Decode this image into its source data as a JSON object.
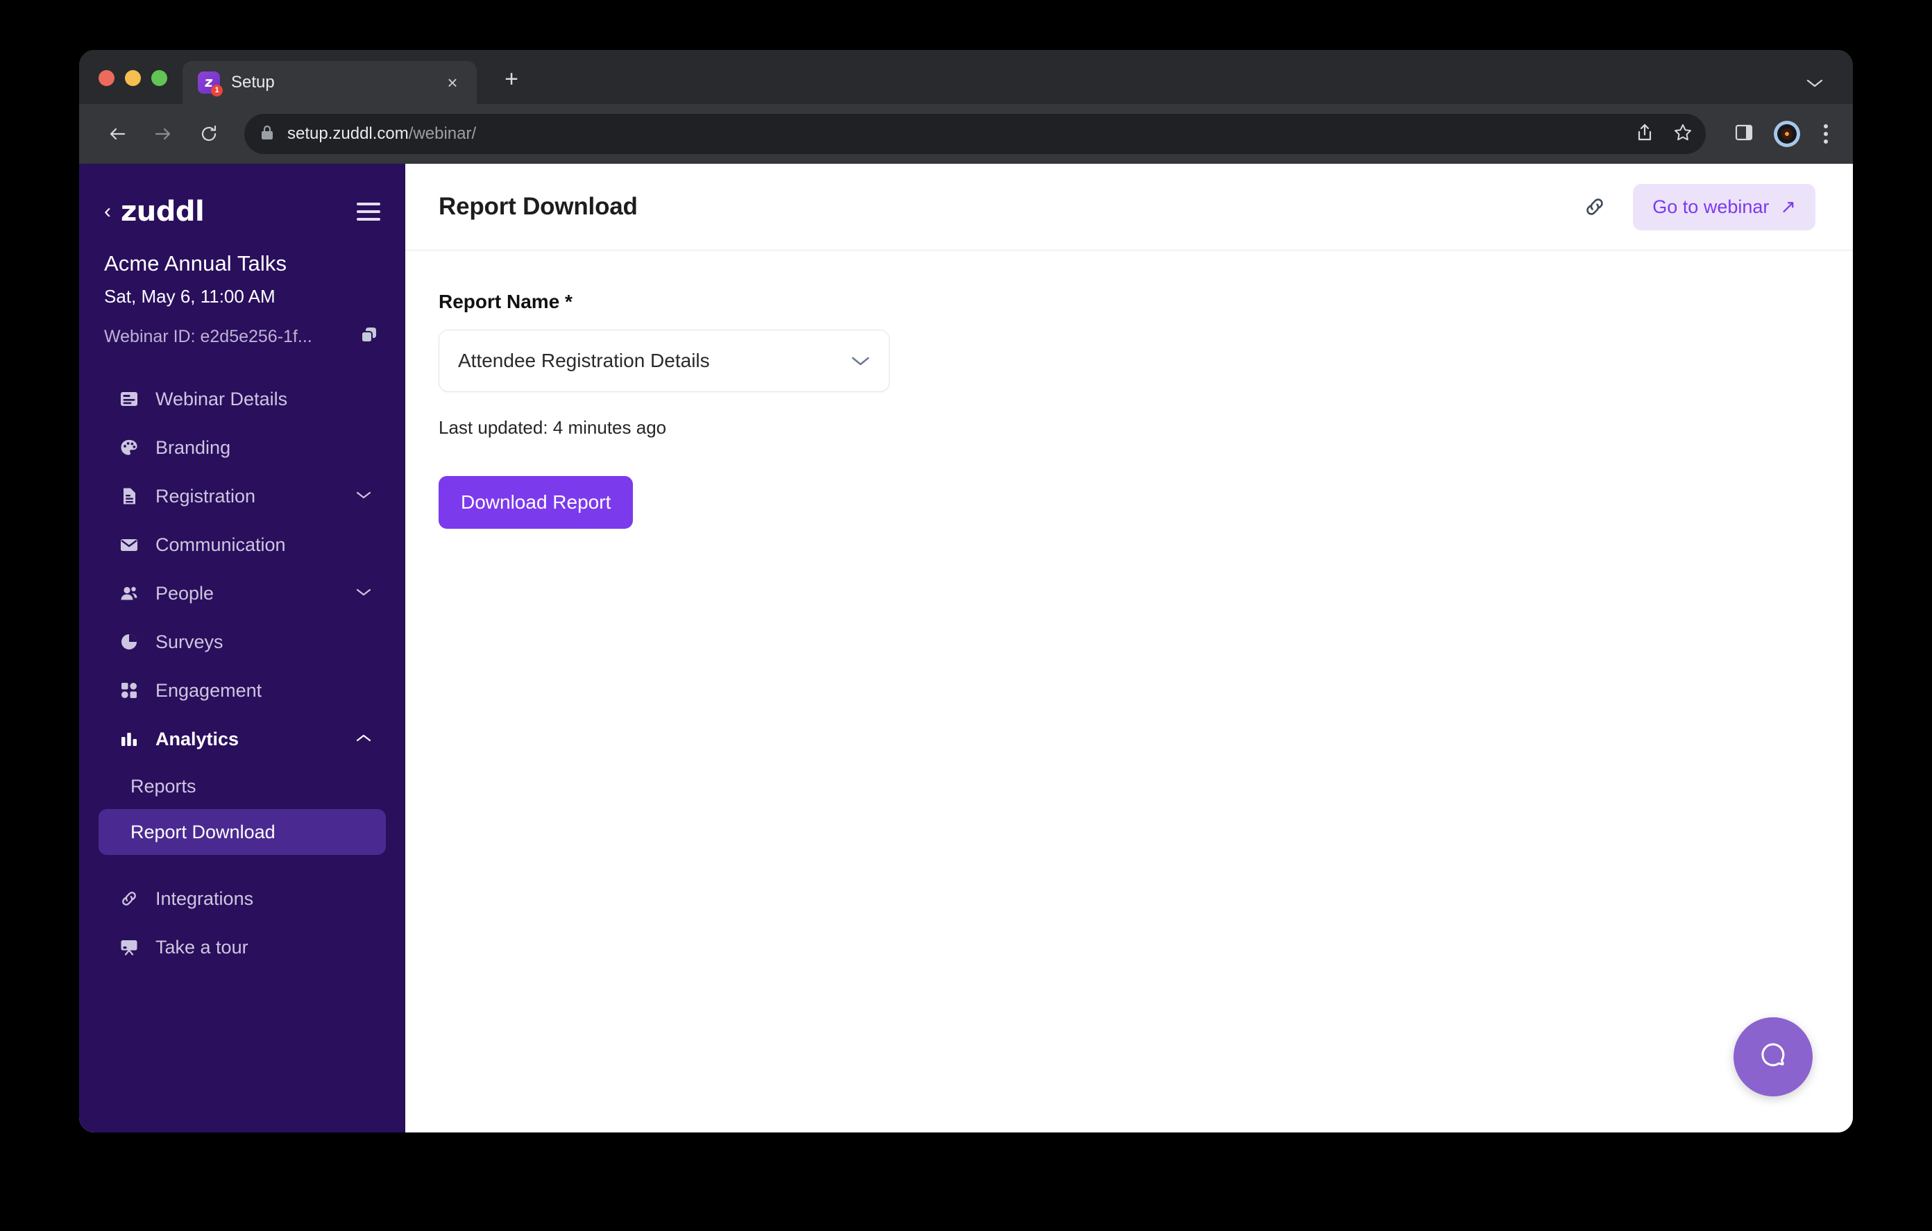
{
  "browser": {
    "tab": {
      "title": "Setup",
      "favicon_glyph": "z",
      "favicon_badge": "1"
    },
    "url": {
      "domain": "setup.zuddl.com",
      "path": "/webinar/"
    },
    "icons": {
      "back": "back-arrow-icon",
      "forward": "forward-arrow-icon",
      "reload": "reload-icon",
      "lock": "lock-icon",
      "share": "share-icon",
      "bookmark": "star-icon",
      "side_panel": "side-panel-icon",
      "profile": "profile-avatar-icon",
      "menu": "kebab-menu-icon",
      "new_tab": "+",
      "tab_list": "chevron-down-icon",
      "tab_close": "×"
    }
  },
  "sidebar": {
    "back_chevron": "‹",
    "logo": "zuddl",
    "event_name": "Acme Annual Talks",
    "event_date": "Sat, May 6, 11:00 AM",
    "webinar_id": "Webinar ID: e2d5e256-1f...",
    "items": [
      {
        "label": "Webinar Details",
        "icon": "webinar-details-icon",
        "caret": "",
        "expanded": false
      },
      {
        "label": "Branding",
        "icon": "palette-icon",
        "caret": "",
        "expanded": false
      },
      {
        "label": "Registration",
        "icon": "document-icon",
        "caret": "⌄",
        "expanded": false
      },
      {
        "label": "Communication",
        "icon": "envelope-icon",
        "caret": "",
        "expanded": false
      },
      {
        "label": "People",
        "icon": "people-icon",
        "caret": "⌄",
        "expanded": false
      },
      {
        "label": "Surveys",
        "icon": "pie-chart-icon",
        "caret": "",
        "expanded": false
      },
      {
        "label": "Engagement",
        "icon": "grid-icon",
        "caret": "",
        "expanded": false
      },
      {
        "label": "Analytics",
        "icon": "bar-chart-icon",
        "caret": "⌃",
        "expanded": true
      }
    ],
    "sub_items": [
      {
        "label": "Reports",
        "active": false
      },
      {
        "label": "Report Download",
        "active": true
      }
    ],
    "bottom_items": [
      {
        "label": "Integrations",
        "icon": "link-chain-icon"
      },
      {
        "label": "Take a tour",
        "icon": "presentation-board-icon"
      }
    ]
  },
  "header": {
    "title": "Report Download",
    "link_icon": "link-chain-icon",
    "go_to_webinar": "Go to webinar",
    "go_to_webinar_arrow": "↗"
  },
  "form": {
    "report_name_label": "Report Name *",
    "selected_report": "Attendee Registration Details",
    "last_updated": "Last updated: 4 minutes ago",
    "download_button": "Download Report"
  },
  "help": {
    "icon": "chat-bubble-icon"
  },
  "colors": {
    "sidebar_bg": "#2a0f5c",
    "sidebar_active": "#4a2a91",
    "accent_purple": "#7c3aed",
    "accent_soft": "#ece3fb",
    "help_bubble": "#8b63cf"
  }
}
